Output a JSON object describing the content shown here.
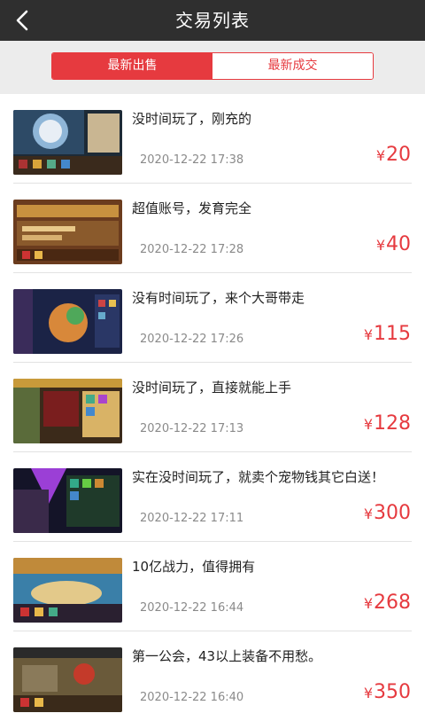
{
  "header": {
    "title": "交易列表",
    "back_icon": "back-chevron-icon"
  },
  "tabs": [
    {
      "label": "最新出售",
      "active": true
    },
    {
      "label": "最新成交",
      "active": false
    }
  ],
  "colors": {
    "accent": "#e63a3f",
    "header_bg": "#2f2f2f",
    "tab_bar_bg": "#ececec"
  },
  "items": [
    {
      "title": "没时间玩了，刚充的",
      "time": "2020-12-22 17:38",
      "currency": "¥",
      "price": "20"
    },
    {
      "title": "超值账号，发育完全",
      "time": "2020-12-22 17:28",
      "currency": "¥",
      "price": "40"
    },
    {
      "title": "没有时间玩了，来个大哥带走",
      "time": "2020-12-22 17:26",
      "currency": "¥",
      "price": "115"
    },
    {
      "title": "没时间玩了，直接就能上手",
      "time": "2020-12-22 17:13",
      "currency": "¥",
      "price": "128"
    },
    {
      "title": "实在没时间玩了，就卖个宠物钱其它白送！",
      "time": "2020-12-22 17:11",
      "currency": "¥",
      "price": "300"
    },
    {
      "title": "10亿战力，值得拥有",
      "time": "2020-12-22 16:44",
      "currency": "¥",
      "price": "268"
    },
    {
      "title": "第一公会，43以上装备不用愁。",
      "time": "2020-12-22 16:40",
      "currency": "¥",
      "price": "350"
    }
  ]
}
